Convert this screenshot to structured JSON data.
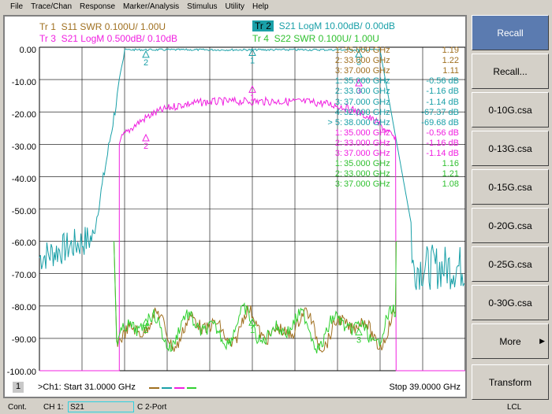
{
  "menu": [
    "File",
    "Trace/Chan",
    "Response",
    "Marker/Analysis",
    "Stimulus",
    "Utility",
    "Help"
  ],
  "traces": [
    {
      "id": "Tr 1",
      "label": "S11 SWR 0.100U/  1.00U",
      "color": "#a07020"
    },
    {
      "id": "Tr 2",
      "label": "S21 LogM 10.00dB/  0.00dB",
      "color": "#1aa0a8",
      "active": true
    },
    {
      "id": "Tr 3",
      "label": "S21 LogM 0.500dB/  0.10dB",
      "color": "#f020e0"
    },
    {
      "id": "Tr 4",
      "label": "S22 SWR 0.100U/  1.00U",
      "color": "#30d030"
    }
  ],
  "y_axis": [
    "0.00",
    "-10.00",
    "-20.00",
    "-30.00",
    "-40.00",
    "-50.00",
    "-60.00",
    "-70.00",
    "-80.00",
    "-90.00",
    "-100.00"
  ],
  "markers": [
    {
      "n": "1:",
      "f": "35.000 GHz",
      "v": "1.19",
      "c": "#a07020"
    },
    {
      "n": "2:",
      "f": "33.000 GHz",
      "v": "1.22",
      "c": "#a07020"
    },
    {
      "n": "3:",
      "f": "37.000 GHz",
      "v": "1.11",
      "c": "#a07020"
    },
    {
      "n": "1:",
      "f": "35.000 GHz",
      "v": "-0.56 dB",
      "c": "#1aa0a8"
    },
    {
      "n": "2:",
      "f": "33.000 GHz",
      "v": "-1.16 dB",
      "c": "#1aa0a8"
    },
    {
      "n": "3:",
      "f": "37.000 GHz",
      "v": "-1.14 dB",
      "c": "#1aa0a8"
    },
    {
      "n": "4:",
      "f": "32.000 GHz",
      "v": "-67.37 dB",
      "c": "#1aa0a8"
    },
    {
      "n": "> 5:",
      "f": "38.000 GHz",
      "v": "-69.68 dB",
      "c": "#1aa0a8"
    },
    {
      "n": "1:",
      "f": "35.000 GHz",
      "v": "-0.56 dB",
      "c": "#f020e0"
    },
    {
      "n": "2:",
      "f": "33.000 GHz",
      "v": "-1.16 dB",
      "c": "#f020e0"
    },
    {
      "n": "3:",
      "f": "37.000 GHz",
      "v": "-1.14 dB",
      "c": "#f020e0"
    },
    {
      "n": "1:",
      "f": "35.000 GHz",
      "v": "1.16",
      "c": "#30c030"
    },
    {
      "n": "2:",
      "f": "33.000 GHz",
      "v": "1.21",
      "c": "#30c030"
    },
    {
      "n": "3:",
      "f": "37.000 GHz",
      "v": "1.08",
      "c": "#30c030"
    }
  ],
  "channel": {
    "num": "1",
    "start": ">Ch1: Start  31.0000 GHz",
    "stop": "Stop  39.0000 GHz"
  },
  "sidebar": [
    "Recall",
    "Recall...",
    "0-10G.csa",
    "0-13G.csa",
    "0-15G.csa",
    "0-20G.csa",
    "0-25G.csa",
    "0-30G.csa",
    "More",
    "Transform"
  ],
  "status": {
    "mode": "Cont.",
    "ch": "CH 1:",
    "param": "S21",
    "cal": "C  2-Port",
    "remote": "LCL"
  }
}
